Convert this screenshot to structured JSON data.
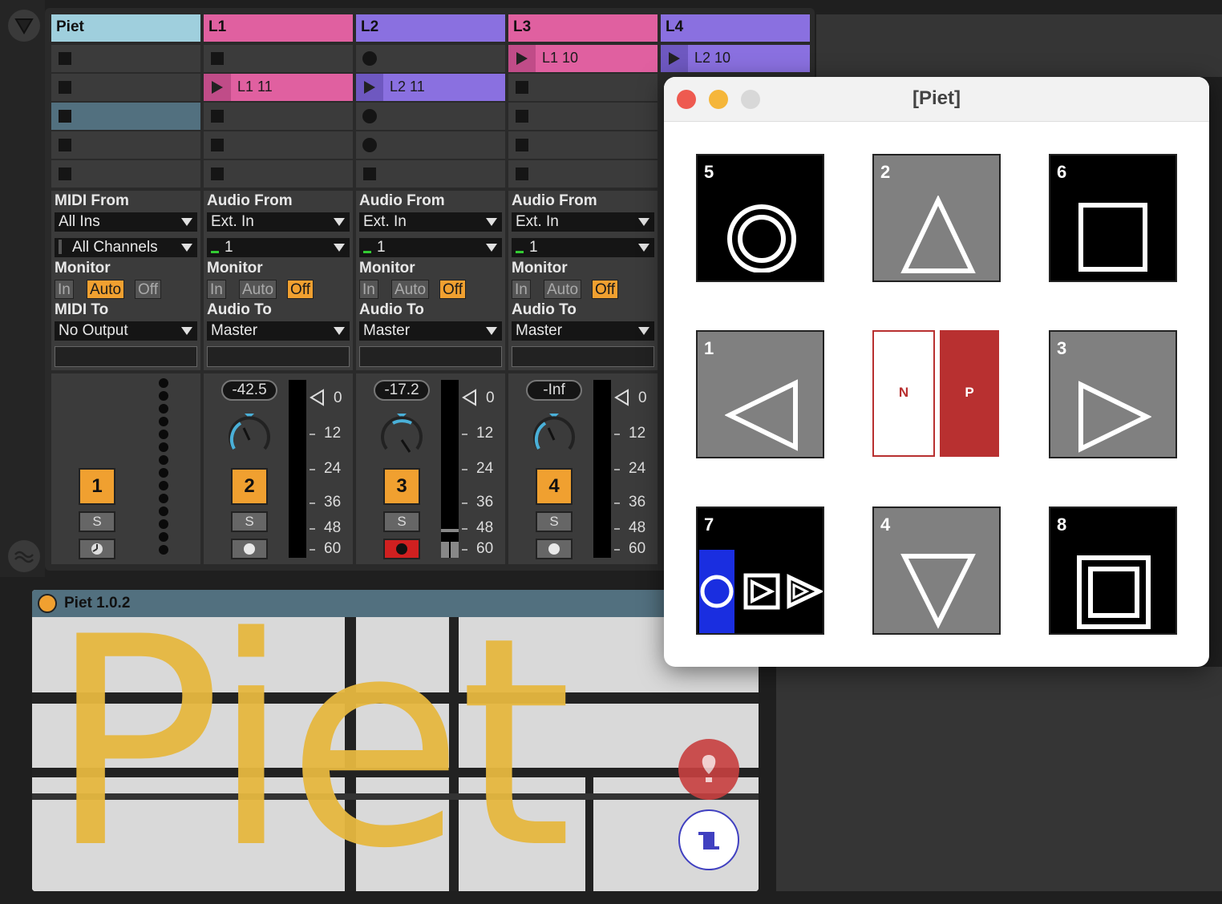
{
  "left_strip": {
    "top_icon": "triangle-down-icon",
    "bottom_icon": "waveform-icon"
  },
  "tracks": [
    {
      "name": "Piet",
      "color": "#9fcfdd",
      "io": {
        "from_label": "MIDI From",
        "from_value": "All Ins",
        "channel": "All Channels",
        "monitor_label": "Monitor",
        "monitor": [
          "In",
          "Auto",
          "Off"
        ],
        "monitor_active": "Auto",
        "to_label": "MIDI To",
        "to_value": "No Output"
      },
      "number": "1",
      "solo": "S"
    },
    {
      "name": "L1",
      "color": "#e060a0",
      "clip": "L1 11",
      "io": {
        "from_label": "Audio From",
        "from_value": "Ext. In",
        "channel": "1",
        "monitor_label": "Monitor",
        "monitor": [
          "In",
          "Auto",
          "Off"
        ],
        "monitor_active": "Off",
        "to_label": "Audio To",
        "to_value": "Master"
      },
      "volume": "-42.5",
      "number": "2",
      "solo": "S"
    },
    {
      "name": "L2",
      "color": "#8a70e0",
      "clip": "L2 11",
      "io": {
        "from_label": "Audio From",
        "from_value": "Ext. In",
        "channel": "1",
        "monitor_label": "Monitor",
        "monitor": [
          "In",
          "Auto",
          "Off"
        ],
        "monitor_active": "Off",
        "to_label": "Audio To",
        "to_value": "Master"
      },
      "volume": "-17.2",
      "number": "3",
      "solo": "S"
    },
    {
      "name": "L3",
      "color": "#e060a0",
      "clip": "L1 10",
      "io": {
        "from_label": "Audio From",
        "from_value": "Ext. In",
        "channel": "1",
        "monitor_label": "Monitor",
        "monitor": [
          "In",
          "Auto",
          "Off"
        ],
        "monitor_active": "Off",
        "to_label": "Audio To",
        "to_value": "Master"
      },
      "volume": "-Inf",
      "number": "4",
      "solo": "S"
    },
    {
      "name": "L4",
      "color": "#8a70e0",
      "clip": "L2 10"
    }
  ],
  "meter_scale": [
    "0",
    "12",
    "24",
    "36",
    "48",
    "60"
  ],
  "device": {
    "title": "Piet 1.0.2",
    "art_text": "Piet",
    "buttons": [
      "balloon-icon",
      "scroll-icon"
    ]
  },
  "popup": {
    "title": "[Piet]",
    "pads": [
      {
        "num": "5",
        "icon": "double-circle-icon"
      },
      {
        "num": "2",
        "icon": "triangle-up-icon"
      },
      {
        "num": "6",
        "icon": "square-icon"
      },
      {
        "num": "1",
        "icon": "triangle-left-icon"
      },
      {
        "n_label": "N",
        "p_label": "P"
      },
      {
        "num": "3",
        "icon": "triangle-right-icon"
      },
      {
        "num": "7",
        "icon": "record-play-icon"
      },
      {
        "num": "4",
        "icon": "triangle-down-icon"
      },
      {
        "num": "8",
        "icon": "double-square-icon"
      }
    ]
  }
}
